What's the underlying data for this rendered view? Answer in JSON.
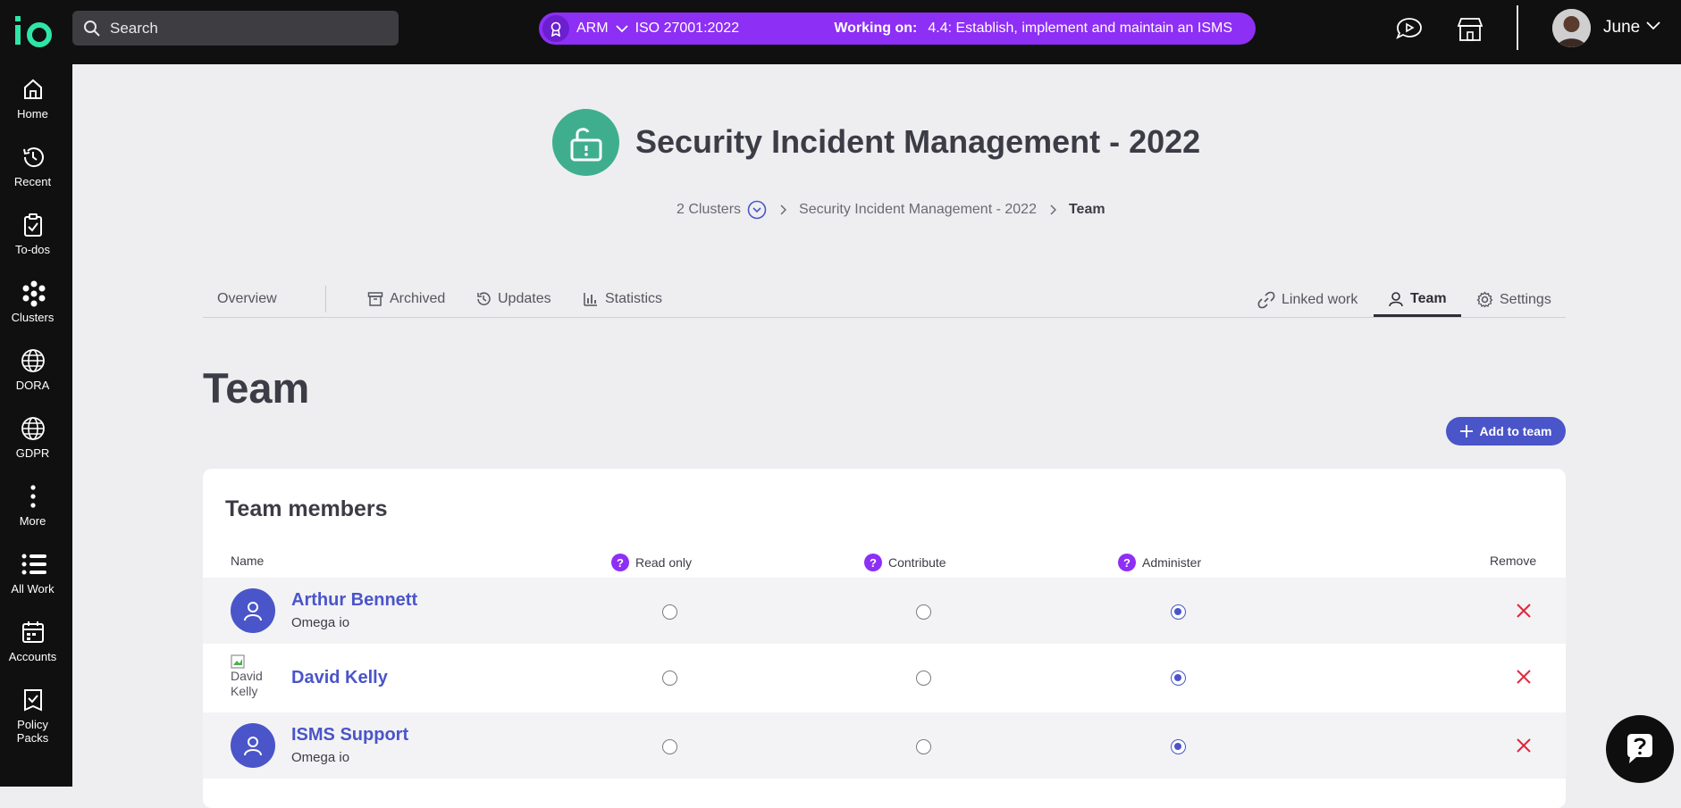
{
  "app": {
    "logo_text": "io"
  },
  "topbar": {
    "search_placeholder": "Search",
    "context": {
      "framework_short": "ARM",
      "standard": "ISO 27001:2022",
      "working_on_label": "Working on:",
      "working_on_value": "4.4: Establish, implement and maintain an ISMS"
    },
    "user": {
      "name": "June"
    }
  },
  "sidebar": {
    "items": [
      {
        "label": "Home",
        "icon": "home-icon"
      },
      {
        "label": "Recent",
        "icon": "history-icon"
      },
      {
        "label": "To-dos",
        "icon": "clipboard-check-icon"
      },
      {
        "label": "Clusters",
        "icon": "clusters-icon"
      },
      {
        "label": "DORA",
        "icon": "globe-icon"
      },
      {
        "label": "GDPR",
        "icon": "globe-icon"
      },
      {
        "label": "More",
        "icon": "more-vertical-icon"
      },
      {
        "label": "All Work",
        "icon": "list-icon"
      },
      {
        "label": "Accounts",
        "icon": "calendar-icon"
      },
      {
        "label": "Policy Packs",
        "icon": "policy-icon"
      }
    ]
  },
  "header": {
    "title": "Security Incident Management - 2022",
    "breadcrumb": {
      "clusters": "2 Clusters",
      "item": "Security Incident Management - 2022",
      "current": "Team"
    }
  },
  "tabs": {
    "overview": "Overview",
    "archived": "Archived",
    "updates": "Updates",
    "statistics": "Statistics",
    "linked_work": "Linked work",
    "team": "Team",
    "settings": "Settings",
    "active": "Team"
  },
  "team": {
    "title": "Team",
    "add_button": "Add to team",
    "card_title": "Team members",
    "columns": {
      "name": "Name",
      "read_only": "Read only",
      "contribute": "Contribute",
      "administer": "Administer",
      "remove": "Remove"
    },
    "members": [
      {
        "name": "Arthur Bennett",
        "org": "Omega io",
        "permission": "Administer"
      },
      {
        "name": "David Kelly",
        "org": "",
        "avatar_alt": "David Kelly",
        "permission": "Administer"
      },
      {
        "name": "ISMS Support",
        "org": "Omega io",
        "permission": "Administer"
      }
    ]
  },
  "colors": {
    "accent_purple": "#8d2ff5",
    "primary_blue": "#4a55c9",
    "teal": "#3fae8f",
    "remove_red": "#e0283c"
  }
}
